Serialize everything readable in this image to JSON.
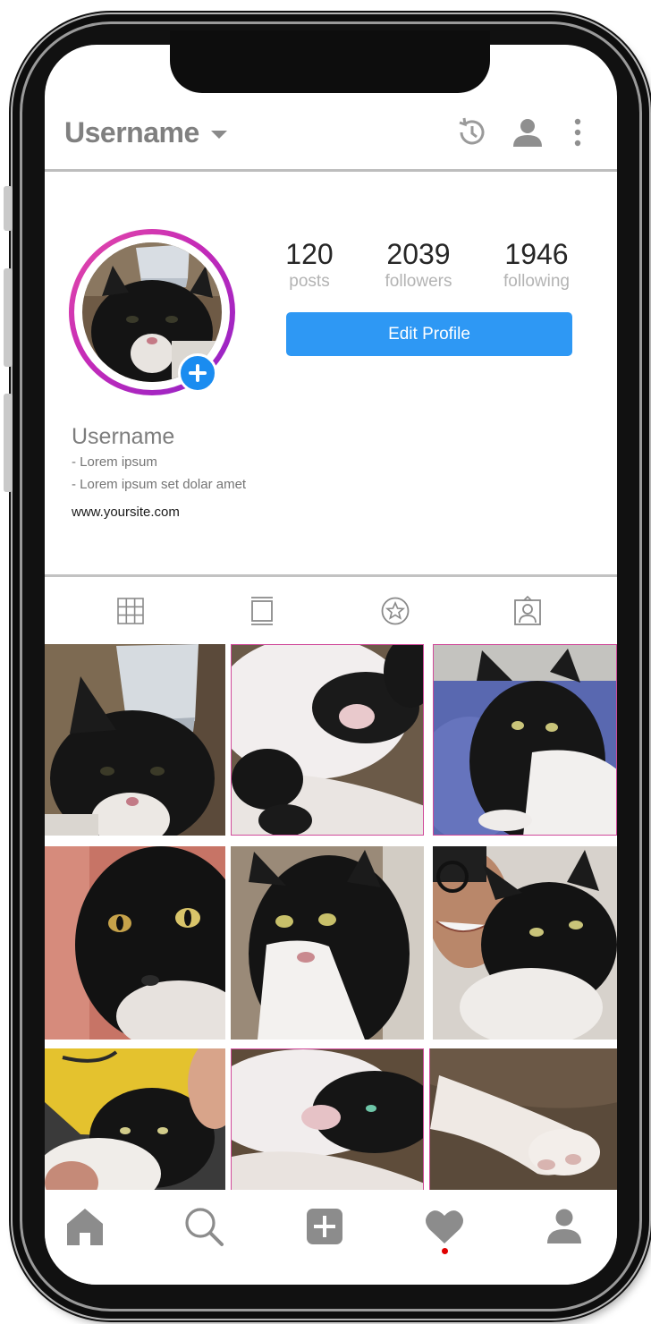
{
  "header": {
    "username": "Username",
    "icons": [
      "chevron-down-icon",
      "history-icon",
      "person-icon",
      "more-vertical-icon"
    ]
  },
  "profile": {
    "stats": [
      {
        "value": "120",
        "label": "posts"
      },
      {
        "value": "2039",
        "label": "followers"
      },
      {
        "value": "1946",
        "label": "following"
      }
    ],
    "edit_button": "Edit Profile",
    "bio": {
      "name": "Username",
      "lines": [
        "- Lorem ipsum",
        "- Lorem ipsum set dolar amet"
      ],
      "link": "www.yoursite.com"
    },
    "story_ring_colors": [
      "#e64aa7",
      "#8e22c9"
    ],
    "add_badge_color": "#1a8cf0"
  },
  "tabs": [
    "grid-icon",
    "feed-icon",
    "star-icon",
    "tagged-icon"
  ],
  "posts": [
    "cat-with-cup-hat",
    "sleeping-cat",
    "cat-on-blue-cushion",
    "cat-closeup-eyes",
    "cat-sitting",
    "person-hugging-cat",
    "cat-in-yellow-hood",
    "sleeping-cat-face",
    "cat-paw"
  ],
  "bottom_nav": {
    "items": [
      "home-icon",
      "search-icon",
      "add-icon",
      "heart-icon",
      "profile-icon"
    ],
    "active_notification": "heart-icon"
  },
  "colors": {
    "accent": "#2e98f4",
    "notification": "#e00000",
    "icon_gray": "#8a8a8a"
  }
}
